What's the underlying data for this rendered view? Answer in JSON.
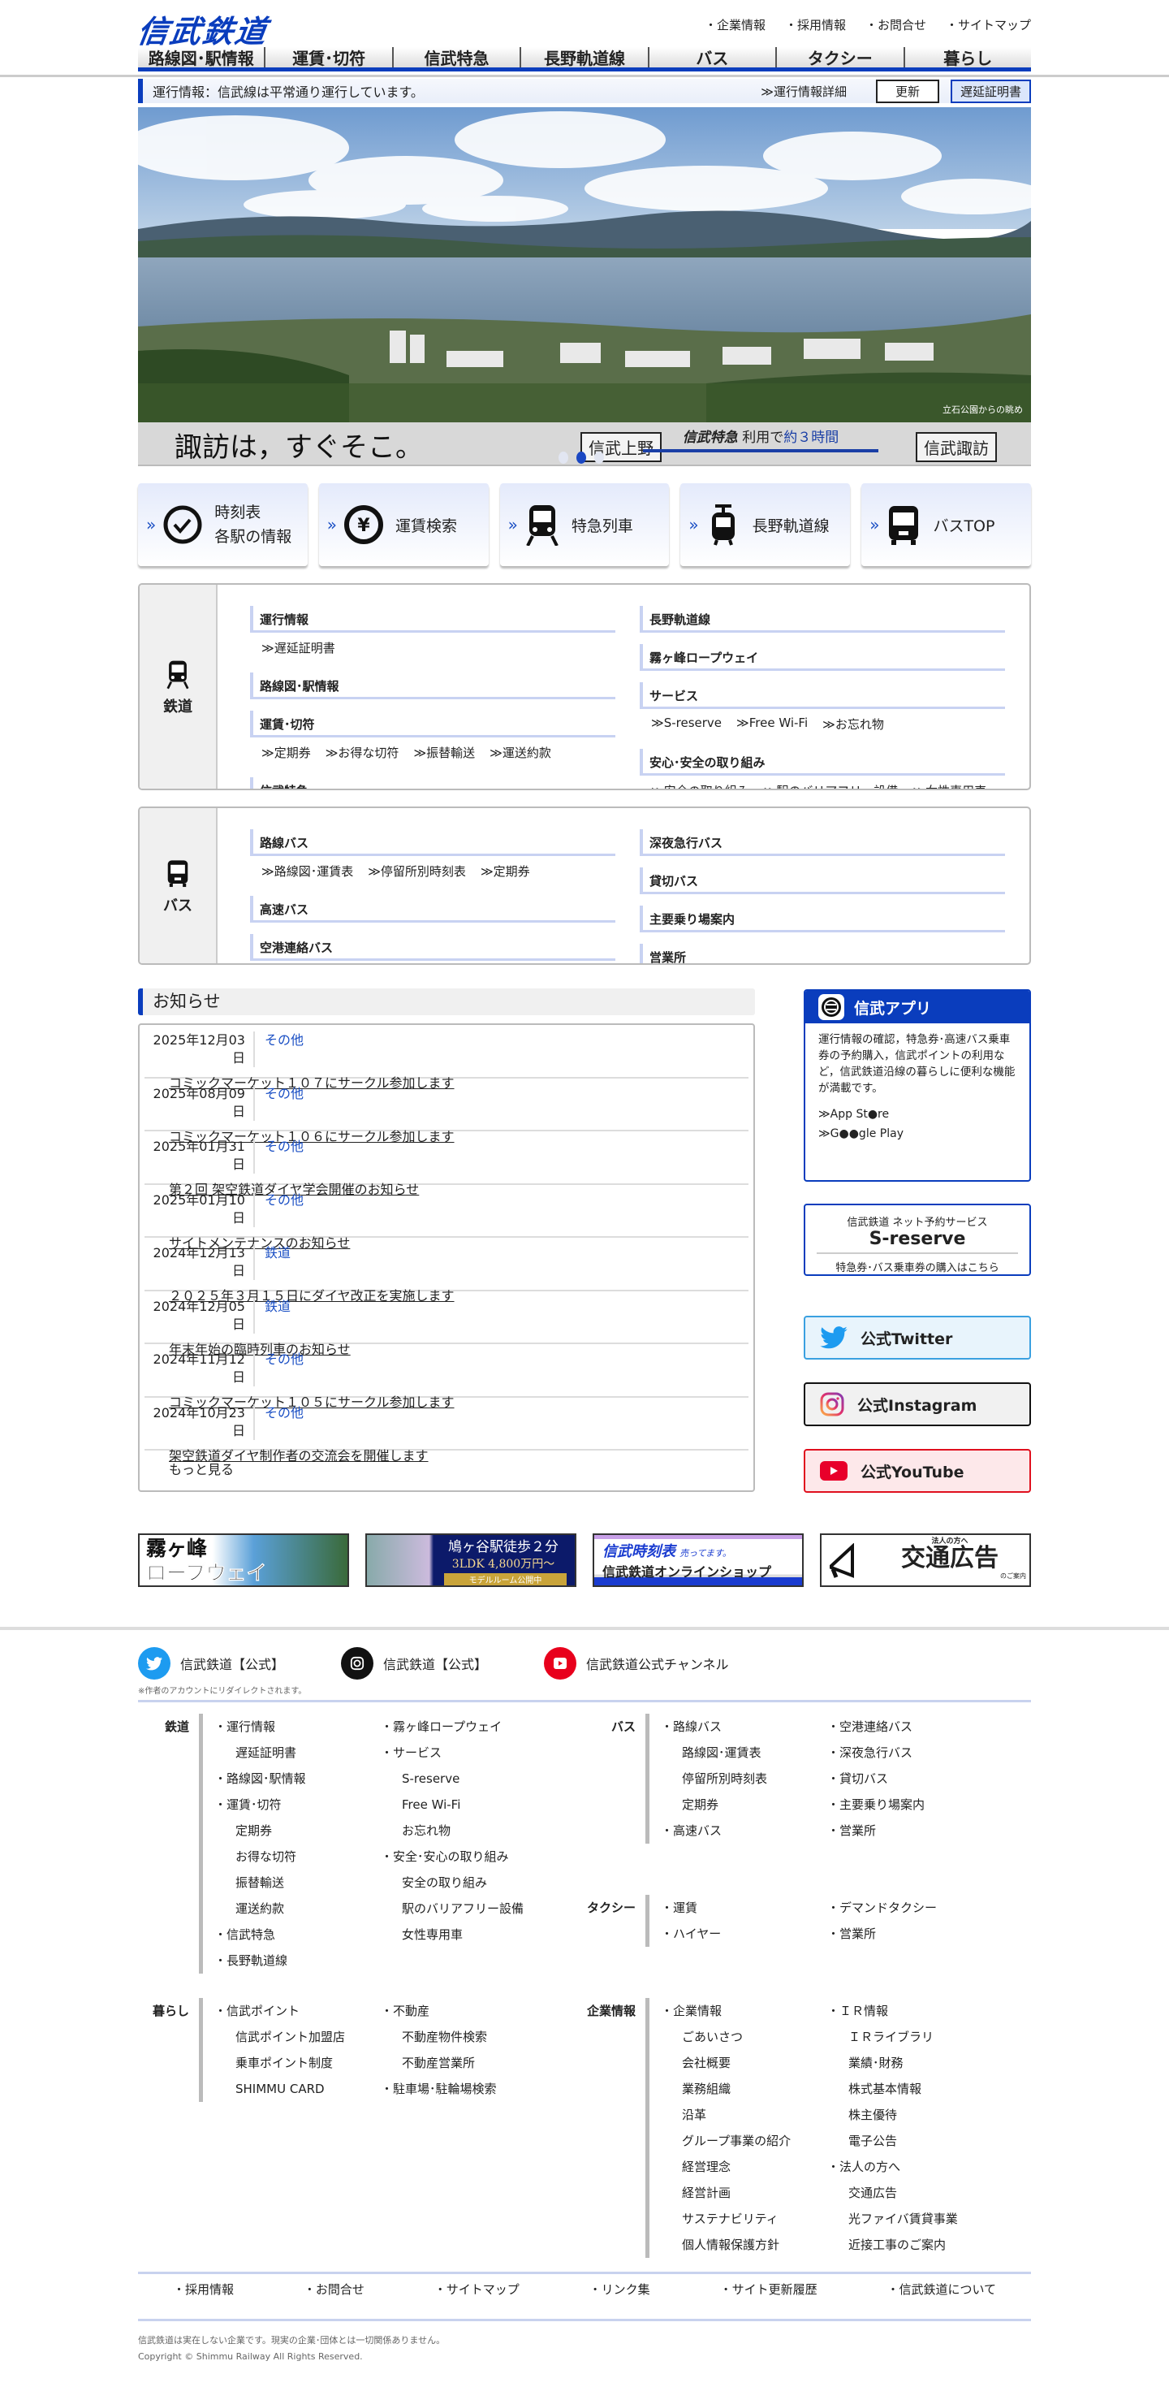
{
  "header": {
    "logo": "信武鉄道",
    "top_links": [
      "・企業情報",
      "・採用情報",
      "・お問合せ",
      "・サイトマップ"
    ]
  },
  "nav": [
    "路線図･駅情報",
    "運賃･切符",
    "信武特急",
    "長野軌道線",
    "バス",
    "タクシー",
    "暮らし"
  ],
  "info_bar": {
    "message": "運行情報：信武線は平常通り運行しています。",
    "detail": "≫運行情報詳細",
    "refresh": "更新",
    "delay_cert": "遅延証明書"
  },
  "hero": {
    "photo_caption": "立石公園からの眺め",
    "slogan": "諏訪は，すぐそこ。",
    "from": "信武上野",
    "to": "信武諏訪",
    "express": "信武特急",
    "via": "利用で",
    "time": "約３時間",
    "slide_count": 3,
    "active_slide": 2
  },
  "quick": [
    {
      "l1": "時刻表",
      "l2": "各駅の情報",
      "icon": "clock-icon"
    },
    {
      "l1": "運賃検索",
      "icon": "yen-icon"
    },
    {
      "l1": "特急列車",
      "icon": "train-icon"
    },
    {
      "l1": "長野軌道線",
      "icon": "tram-icon"
    },
    {
      "l1": "バスTOP",
      "icon": "bus-icon"
    }
  ],
  "rail": {
    "label": "鉄道",
    "left": [
      {
        "h": "運行情報",
        "subs": [
          "≫遅延証明書"
        ]
      },
      {
        "h": "路線図･駅情報"
      },
      {
        "h": "運賃･切符",
        "subs": [
          "≫定期券",
          "≫お得な切符",
          "≫振替輸送",
          "≫運送約款"
        ]
      },
      {
        "h": "信武特急"
      }
    ],
    "right": [
      {
        "h": "長野軌道線"
      },
      {
        "h": "霧ヶ峰ロープウェイ"
      },
      {
        "h": "サービス",
        "subs": [
          "≫S-reserve",
          "≫Free Wi-Fi",
          "≫お忘れ物"
        ]
      },
      {
        "h": "安心･安全の取り組み",
        "subs": [
          "≫安全の取り組み",
          "≫駅のバリアフリー設備",
          "≫女性専用車"
        ]
      }
    ]
  },
  "bus": {
    "label": "バス",
    "left": [
      {
        "h": "路線バス",
        "subs": [
          "≫路線図･運賃表",
          "≫停留所別時刻表",
          "≫定期券"
        ]
      },
      {
        "h": "高速バス"
      },
      {
        "h": "空港連絡バス"
      }
    ],
    "right": [
      {
        "h": "深夜急行バス"
      },
      {
        "h": "貸切バス"
      },
      {
        "h": "主要乗り場案内"
      },
      {
        "h": "営業所"
      }
    ]
  },
  "news": {
    "title": "お知らせ",
    "more": "もっと見る",
    "items": [
      {
        "date": "2025年12月03日",
        "cat": "その他",
        "title": "コミックマーケット１０７にサークル参加します"
      },
      {
        "date": "2025年08月09日",
        "cat": "その他",
        "title": "コミックマーケット１０６にサークル参加します"
      },
      {
        "date": "2025年01月31日",
        "cat": "その他",
        "title": "第２回 架空鉄道ダイヤ学会開催のお知らせ"
      },
      {
        "date": "2025年01月10日",
        "cat": "その他",
        "title": "サイトメンテナンスのお知らせ"
      },
      {
        "date": "2024年12月13日",
        "cat": "鉄道",
        "title": "２０２５年３月１５日にダイヤ改正を実施します"
      },
      {
        "date": "2024年12月05日",
        "cat": "鉄道",
        "title": "年末年始の臨時列車のお知らせ"
      },
      {
        "date": "2024年11月12日",
        "cat": "その他",
        "title": "コミックマーケット１０５にサークル参加します"
      },
      {
        "date": "2024年10月23日",
        "cat": "その他",
        "title": "架空鉄道ダイヤ制作者の交流会を開催します"
      }
    ]
  },
  "app": {
    "title": "信武アプリ",
    "desc": "運行情報の確認，特急券･高速バス乗車券の予約購入，信武ポイントの利用など，信武鉄道沿線の暮らしに便利な機能が満載です。",
    "app_store": "≫App St●re",
    "google_play": "≫G●●gle Play"
  },
  "sreserve": {
    "top": "信武鉄道 ネット予約サービス",
    "name": "S-reserve",
    "bottom": "特急券･バス乗車券の購入はこちら"
  },
  "social": {
    "twitter": "公式Twitter",
    "instagram": "公式Instagram",
    "youtube": "公式YouTube"
  },
  "banners": {
    "ropeway": [
      "霧ヶ峰",
      "ロープウェイ"
    ],
    "realestate": [
      "鳩ヶ谷駅徒歩２分",
      "3LDK 4,800万円～",
      "モデルルーム公開中"
    ],
    "shop": [
      "信武時刻表",
      "売ってます。",
      "信武鉄道オンラインショップ"
    ],
    "ad": [
      "法人の方へ",
      "交通広告",
      "のご案内"
    ]
  },
  "footer_social": {
    "items": [
      "信武鉄道【公式】",
      "信武鉄道【公式】",
      "信武鉄道公式チャンネル"
    ],
    "note": "※作者のアカウントにリダイレクトされます。"
  },
  "sitemap": {
    "rail": {
      "label": "鉄道",
      "c1": [
        "・運行情報",
        "+遅延証明書",
        "・路線図･駅情報",
        "・運賃･切符",
        "+定期券",
        "+お得な切符",
        "+振替輸送",
        "+運送約款",
        "・信武特急",
        "・長野軌道線"
      ],
      "c2": [
        "・霧ヶ峰ロープウェイ",
        "・サービス",
        "+S-reserve",
        "+Free Wi-Fi",
        "+お忘れ物",
        "・安全･安心の取り組み",
        "+安全の取り組み",
        "+駅のバリアフリー設備",
        "+女性専用車"
      ]
    },
    "life": {
      "label": "暮らし",
      "c1": [
        "・信武ポイント",
        "+信武ポイント加盟店",
        "+乗車ポイント制度",
        "+SHIMMU CARD"
      ],
      "c2": [
        "・不動産",
        "+不動産物件検索",
        "+不動産営業所",
        "・駐車場･駐輪場検索"
      ]
    },
    "bus": {
      "label": "バス",
      "c1": [
        "・路線バス",
        "+路線図･運賃表",
        "+停留所別時刻表",
        "+定期券",
        "・高速バス"
      ],
      "c2": [
        "・空港連絡バス",
        "・深夜急行バス",
        "・貸切バス",
        "・主要乗り場案内",
        "・営業所"
      ]
    },
    "taxi": {
      "label": "タクシー",
      "c1": [
        "・運賃",
        "・ハイヤー"
      ],
      "c2": [
        "・デマンドタクシー",
        "・営業所"
      ]
    },
    "corp": {
      "label": "企業情報",
      "c1": [
        "・企業情報",
        "+ごあいさつ",
        "+会社概要",
        "+業務組織",
        "+沿革",
        "+グループ事業の紹介",
        "+経営理念",
        "+経営計画",
        "+サステナビリティ",
        "+個人情報保護方針"
      ],
      "c2": [
        "・ＩＲ情報",
        "+ＩＲライブラリ",
        "+業績･財務",
        "+株式基本情報",
        "+株主優待",
        "+電子公告",
        "・法人の方へ",
        "+交通広告",
        "+光ファイバ賃貸事業",
        "+近接工事のご案内"
      ]
    }
  },
  "bottom_links": [
    "・採用情報",
    "・お問合せ",
    "・サイトマップ",
    "・リンク集",
    "・サイト更新履歴",
    "・信武鉄道について"
  ],
  "copyright": {
    "disclaimer": "信武鉄道は実在しない企業です。現実の企業･団体とは一切関係ありません。",
    "text": "Copyright © Shimmu Railway All Rights Reserved."
  }
}
